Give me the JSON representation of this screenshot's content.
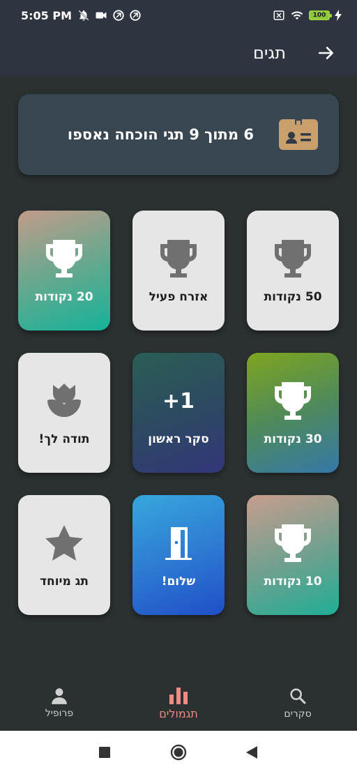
{
  "status_bar": {
    "time": "5:05 PM",
    "battery": "100"
  },
  "app_bar": {
    "title": "תגים"
  },
  "summary": {
    "text": "6 מתוך 9 תגי הוכחה נאספו"
  },
  "badges": [
    {
      "label": "50 נקודות",
      "icon": "trophy-icon",
      "earned": false
    },
    {
      "label": "אזרח פעיל",
      "icon": "trophy-icon",
      "earned": false
    },
    {
      "label": "20 נקודות",
      "icon": "trophy-icon",
      "earned": true
    },
    {
      "label": "30 נקודות",
      "icon": "trophy-icon",
      "earned": true
    },
    {
      "label": "סקר ראשון",
      "icon": "plus-one-icon",
      "icon_text": "+1",
      "earned": true
    },
    {
      "label": "תודה לך!",
      "icon": "tulip-icon",
      "earned": false
    },
    {
      "label": "10 נקודות",
      "icon": "trophy-icon",
      "earned": true
    },
    {
      "label": "שלום!",
      "icon": "door-icon",
      "earned": true
    },
    {
      "label": "תג מיוחד",
      "icon": "star-icon",
      "earned": false
    }
  ],
  "bottom_nav": {
    "surveys": "סקרים",
    "rewards": "תגמולים",
    "profile": "פרופיל",
    "active": "rewards"
  },
  "colors": {
    "background": "#2b3030",
    "app_bar": "#2f3540",
    "summary_card": "#374651",
    "active_nav": "#f08a84"
  }
}
